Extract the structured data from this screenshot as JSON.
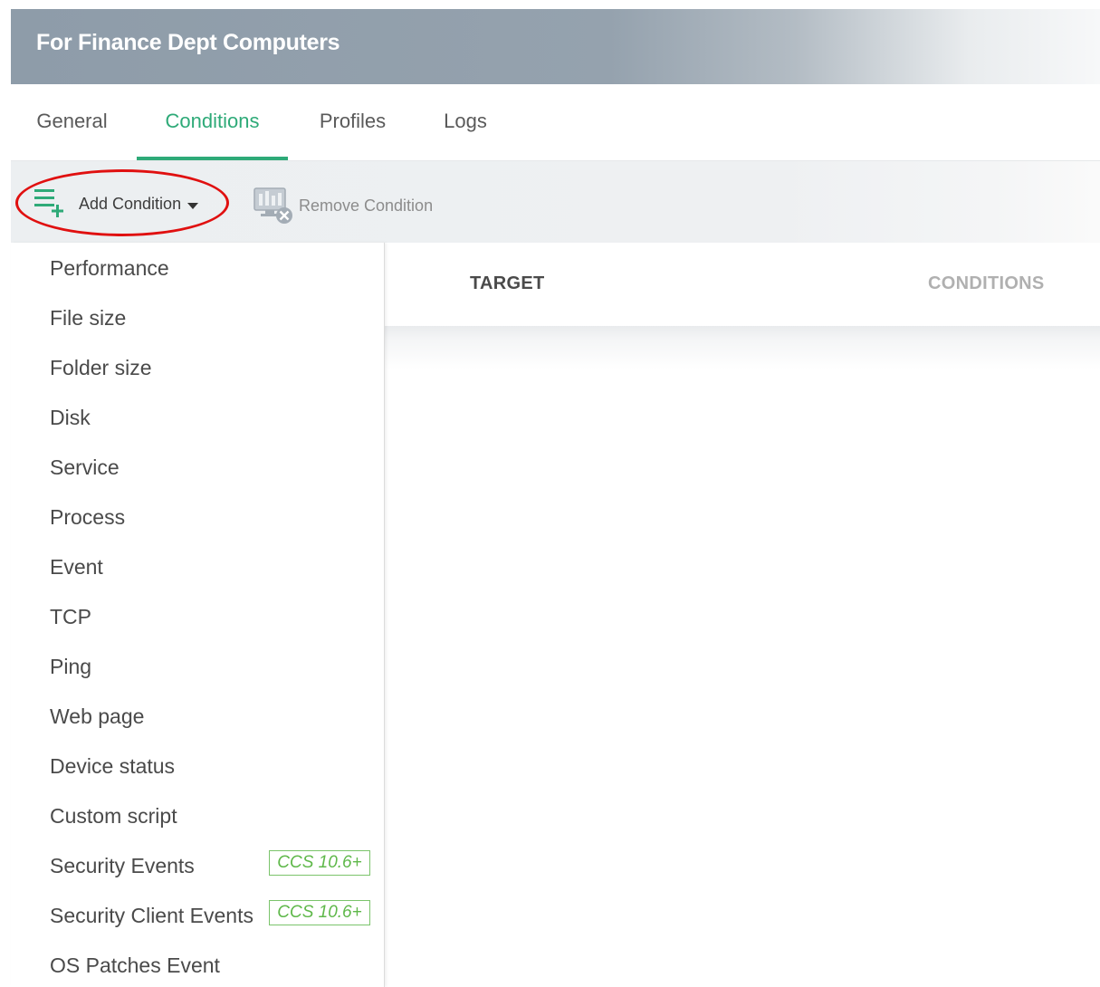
{
  "header": {
    "title": "For Finance Dept Computers"
  },
  "tabs": [
    {
      "label": "General"
    },
    {
      "label": "Conditions"
    },
    {
      "label": "Profiles"
    },
    {
      "label": "Logs"
    }
  ],
  "active_tab": "Conditions",
  "toolbar": {
    "add_condition_label": "Add Condition",
    "remove_condition_label": "Remove Condition"
  },
  "table": {
    "columns": [
      "TARGET",
      "CONDITIONS"
    ]
  },
  "dropdown": {
    "items": [
      {
        "label": "Performance"
      },
      {
        "label": "File size"
      },
      {
        "label": "Folder size"
      },
      {
        "label": "Disk"
      },
      {
        "label": "Service"
      },
      {
        "label": "Process"
      },
      {
        "label": "Event"
      },
      {
        "label": "TCP"
      },
      {
        "label": "Ping"
      },
      {
        "label": "Web page"
      },
      {
        "label": "Device status"
      },
      {
        "label": "Custom script"
      },
      {
        "label": "Security Events",
        "badge": "CCS 10.6+"
      },
      {
        "label": "Security Client Events",
        "badge": "CCS 10.6+"
      },
      {
        "label": "OS Patches Event"
      }
    ]
  },
  "colors": {
    "accent": "#2eaa78",
    "header_bg": "#8e9ca9",
    "badge": "#5fb84a",
    "highlight_oval": "#e01010"
  },
  "icons": {
    "add_condition": "list-add-icon",
    "remove_condition": "monitor-remove-icon",
    "dropdown_caret": "caret-down-icon"
  }
}
